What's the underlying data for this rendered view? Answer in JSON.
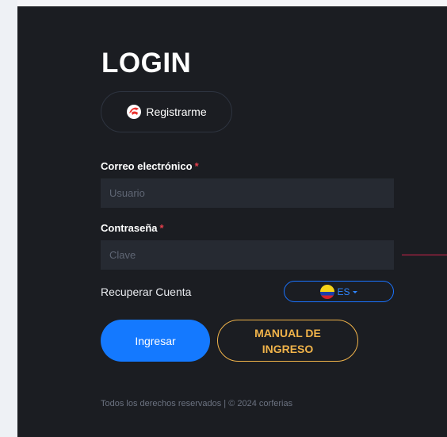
{
  "login": {
    "title": "LOGIN",
    "register_label": "Registrarme",
    "email": {
      "label": "Correo electrónico",
      "required_mark": "*",
      "placeholder": "Usuario",
      "value": ""
    },
    "password": {
      "label": "Contraseña",
      "required_mark": "*",
      "placeholder": "Clave",
      "value": ""
    },
    "recover_label": "Recuperar Cuenta",
    "language": {
      "value": "ES",
      "flag_icon": "colombia-flag-icon"
    },
    "submit_label": "Ingresar",
    "manual_label": "MANUAL DE INGRESO",
    "footer": "Todos los derechos reservados | © 2024 corferias"
  },
  "colors": {
    "panel_bg": "#1b1d22",
    "field_bg": "#262a32",
    "primary": "#1479ff",
    "accent": "#f0b34a",
    "required": "#e43f4b"
  },
  "icons": {
    "register": "register-logo-icon"
  }
}
